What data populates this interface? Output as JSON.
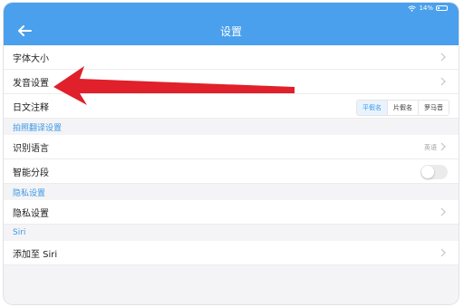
{
  "status_bar": {
    "battery": "14%",
    "wifi_icon": "wifi-icon",
    "battery_icon": "battery-icon"
  },
  "nav": {
    "title": "设置",
    "back_icon": "back-arrow-icon"
  },
  "rows": {
    "font_size": {
      "label": "字体大小"
    },
    "pronunciation": {
      "label": "发音设置"
    },
    "japanese_annotation": {
      "label": "日文注释",
      "options": [
        "平假名",
        "片假名",
        "罗马音"
      ],
      "selected": "平假名"
    },
    "section_photo": {
      "label": "拍照翻译设置"
    },
    "recognition_language": {
      "label": "识别语言",
      "value": "英语"
    },
    "smart_segment": {
      "label": "智能分段",
      "enabled": false
    },
    "section_privacy": {
      "label": "隐私设置"
    },
    "privacy": {
      "label": "隐私设置"
    },
    "section_siri": {
      "label": "Siri"
    },
    "add_to_siri": {
      "label": "添加至 Siri"
    }
  },
  "colors": {
    "accent": "#4aa0ec",
    "section_text": "#3a97e6",
    "annotation_arrow": "#e0202a"
  }
}
